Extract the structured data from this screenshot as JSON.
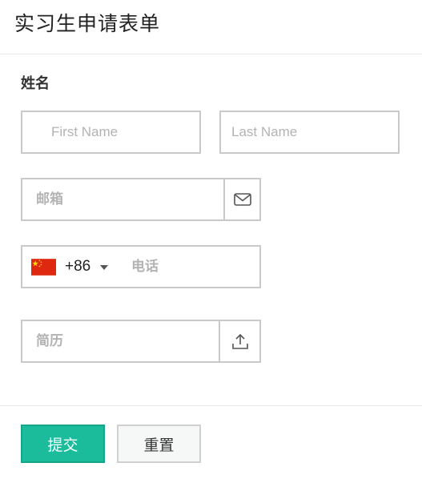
{
  "form": {
    "title": "实习生申请表单",
    "name_section_label": "姓名",
    "first_name": {
      "placeholder": "First Name",
      "value": ""
    },
    "last_name": {
      "placeholder": "Last Name",
      "value": ""
    },
    "email": {
      "placeholder": "邮箱",
      "value": "",
      "addon_icon": "envelope-icon"
    },
    "phone": {
      "country_code": "+86",
      "country_flag": "china-flag",
      "placeholder": "电话",
      "value": ""
    },
    "resume": {
      "placeholder": "简历",
      "value": "",
      "addon_icon": "upload-icon"
    },
    "submit_label": "提交",
    "reset_label": "重置"
  },
  "colors": {
    "accent": "#1abc9c",
    "border": "#c9c9c9",
    "placeholder": "#b3b3b3",
    "flag_red": "#de2910",
    "flag_yellow": "#ffde00"
  }
}
